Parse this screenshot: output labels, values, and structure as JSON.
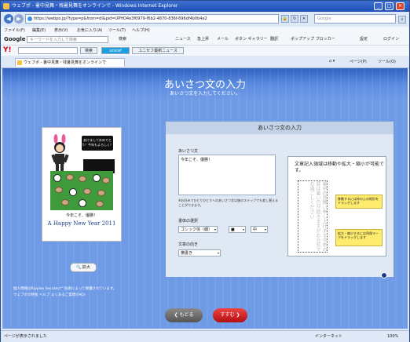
{
  "window": {
    "title": "ウェブポ - 暑中見舞・残暑見舞をオンラインで - Windows Internet Explorer"
  },
  "address": {
    "url": "https://webpo.jp/?type=p&from=dl&pid=UPHO4e3f0979-f6b2-4870-836f-696df4b0b4e2"
  },
  "search": {
    "placeholder": "Google"
  },
  "menu": {
    "items": [
      "ファイル(F)",
      "編集(E)",
      "表示(V)",
      "お気に入り(A)",
      "ツール(T)",
      "ヘルプ(H)"
    ]
  },
  "google_bar": {
    "logo": "Google",
    "placeholder": "キーワードを入力して検索",
    "search_label": "検索",
    "tools": [
      "ニュース",
      "急上昇",
      "メール",
      "ボタン ギャラリー",
      "翻訳",
      "ポップアップ ブロッカー"
    ],
    "settings": "設定",
    "login": "ログイン"
  },
  "yahoo_bar": {
    "logo": "Y!",
    "search_label": "検索",
    "unicef": "unicef",
    "news_label": "ユニセフ最新ニュース"
  },
  "tab": {
    "label": "ウェブポ - 暑中見舞・残暑見舞をオンラインで"
  },
  "right_tools": {
    "page": "ページ(P)",
    "tools": "ツール(O)"
  },
  "page": {
    "title": "あいさつ文の入力",
    "subtitle": "あいさつ文を入力してください。",
    "card": {
      "bubble": "あけましておめでとう！今年もよろしく！",
      "message": "今年こそ、優勝！",
      "greeting": "A Happy New Year 2011"
    },
    "zoom_label": "拡大",
    "panel": {
      "heading": "あいさつ文の入力",
      "greeting_label": "あいさつ文",
      "greeting_value": "今年こそ、優勝！",
      "note": "※お好みでひとりひとりへのあいさつ文は後のステップでも差し替えることができます。",
      "font_label": "書体の選択",
      "font_value": "ゴシック体（細）",
      "color_value": "■",
      "size_value": "中",
      "direction_label": "文章の向き",
      "direction_value": "横書き",
      "preview_text": "文章記入領域は移動や拡大・縮小が可能です。",
      "preview_vertical": "暑中お見舞い申し上げます今年の夏は暑い日が続きますがお元気でお過ごしください",
      "tip_move": "移動するには枠の上の矩形をドラッグします",
      "tip_resize": "拡大・縮小するには四角マークをドラッグします"
    },
    "footer": {
      "privacy": "個人情報はRipplex Secutect™技術によって保護されています。",
      "links": "ウェブポの特長 ヘルプ よくあるご質問(FAQ)"
    },
    "back_button": "もどる",
    "next_button": "すすむ"
  },
  "status": {
    "left": "ページが表示されました",
    "zone": "インターネット",
    "zoom": "100%"
  }
}
